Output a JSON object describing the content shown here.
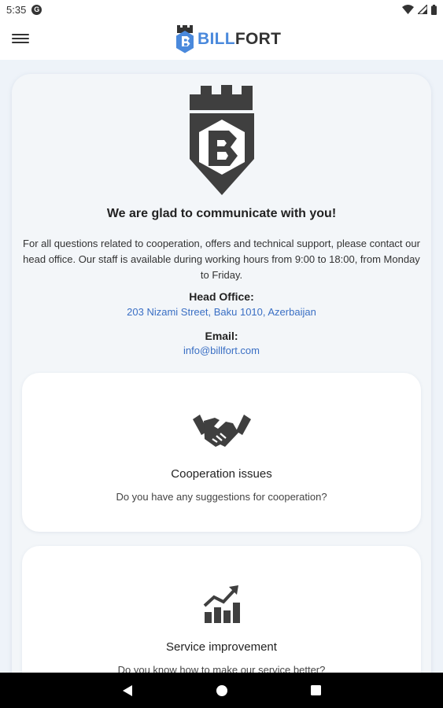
{
  "status_bar": {
    "time": "5:35",
    "app_icon_letter": "G"
  },
  "header": {
    "brand_part1": "BILL",
    "brand_part2": "FORT",
    "brand_color": "#4a89dc"
  },
  "main": {
    "heading": "We are glad to communicate with you!",
    "description": "For all questions related to cooperation, offers and technical support, please contact our head office. Our staff is available during working hours from 9:00 to 18:00, from Monday to Friday.",
    "office_label": "Head Office:",
    "office_address": "203 Nizami Street, Baku 1010, Azerbaijan",
    "email_label": "Email:",
    "email": "info@billfort.com",
    "link_color": "#3a6fc4"
  },
  "cards": [
    {
      "icon": "handshake-icon",
      "title": "Cooperation issues",
      "subtitle": "Do you have any suggestions for cooperation?"
    },
    {
      "icon": "growth-chart-icon",
      "title": "Service improvement",
      "subtitle": "Do you know how to make our service better?"
    }
  ]
}
